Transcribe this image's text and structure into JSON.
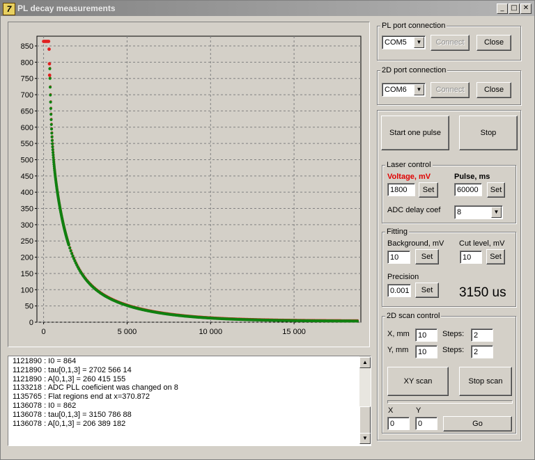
{
  "window": {
    "title": "PL decay measurements",
    "icon": "7",
    "min": "_",
    "max": "□",
    "close": "✕"
  },
  "pl_port": {
    "legend": "PL port connection",
    "port": "COM5",
    "connect": "Connect",
    "close": "Close"
  },
  "port2d": {
    "legend": "2D port connection",
    "port": "COM6",
    "connect": "Connect",
    "close": "Close"
  },
  "controls": {
    "start": "Start one pulse",
    "stop": "Stop"
  },
  "laser": {
    "legend": "Laser control",
    "voltage_label": "Voltage, mV",
    "voltage": "1800",
    "voltage_set": "Set",
    "pulse_label": "Pulse, ms",
    "pulse": "60000",
    "pulse_set": "Set",
    "adc_label": "ADC delay coef",
    "adc": "8"
  },
  "fitting": {
    "legend": "Fitting",
    "bg_label": "Background, mV",
    "bg": "10",
    "bg_set": "Set",
    "cut_label": "Cut level, mV",
    "cut": "10",
    "cut_set": "Set",
    "prec_label": "Precision",
    "prec": "0.001",
    "prec_set": "Set",
    "result": "3150 us"
  },
  "scan": {
    "legend": "2D scan control",
    "x_label": "X, mm",
    "x": "10",
    "x_steps_label": "Steps:",
    "x_steps": "2",
    "y_label": "Y, mm",
    "y": "10",
    "y_steps_label": "Steps:",
    "y_steps": "2",
    "xy_scan": "XY scan",
    "stop_scan": "Stop scan",
    "go_x_label": "X",
    "go_x": "0",
    "go_y_label": "Y",
    "go_y": "0",
    "go": "Go"
  },
  "log": [
    "1121890 : I0 = 864",
    "1121890 : tau[0,1,3] = 2702 566 14",
    "1121890 : A[0,1,3] = 260 415 155",
    "1133218 : ADC PLL coeficient was changed on 8",
    "1135765 : Flat regions end at x=370.872",
    "1136078 : I0 = 862",
    "1136078 : tau[0,1,3] = 3150 786 88",
    "1136078 : A[0,1,3] = 206 389 182"
  ],
  "chart_data": {
    "type": "scatter",
    "x_ticks": [
      "0",
      "5 000",
      "10 000",
      "15 000"
    ],
    "y_ticks": [
      "0",
      "50",
      "100",
      "150",
      "200",
      "250",
      "300",
      "350",
      "400",
      "450",
      "500",
      "550",
      "600",
      "650",
      "700",
      "750",
      "800",
      "850"
    ],
    "xlim": [
      -400,
      19000
    ],
    "ylim": [
      0,
      880
    ],
    "grid": true,
    "colors": {
      "measured": "#e02020",
      "fit": "#108010"
    },
    "series": [
      {
        "kind": "measured",
        "points": [
          [
            0,
            864
          ],
          [
            60,
            864
          ],
          [
            120,
            864
          ],
          [
            180,
            864
          ],
          [
            240,
            864
          ],
          [
            300,
            864
          ],
          [
            330,
            840
          ],
          [
            350,
            795
          ],
          [
            360,
            760
          ]
        ]
      },
      {
        "kind": "fit",
        "model": {
          "I0": 862,
          "tau": [
            3150,
            786,
            88
          ],
          "A": [
            206,
            389,
            182
          ],
          "x0": 370,
          "bg": 3
        }
      }
    ]
  }
}
